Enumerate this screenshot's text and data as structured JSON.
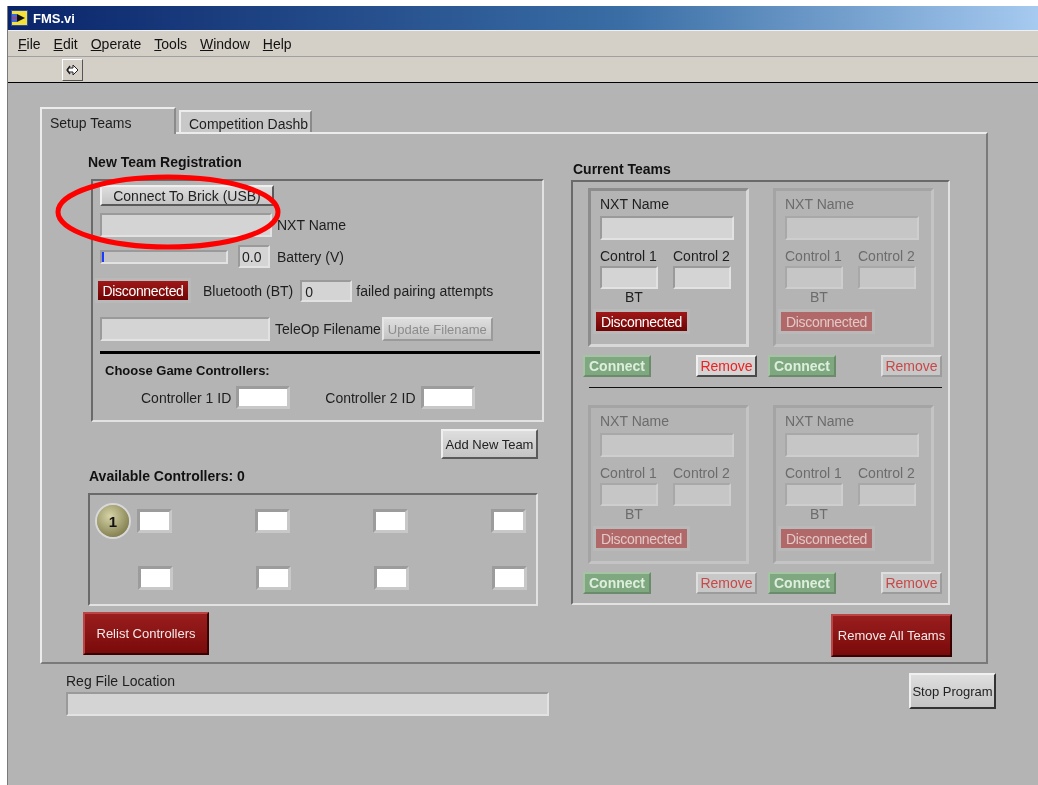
{
  "window": {
    "title": "FMS.vi"
  },
  "menu": [
    {
      "label": "File"
    },
    {
      "label": "Edit"
    },
    {
      "label": "Operate"
    },
    {
      "label": "Tools"
    },
    {
      "label": "Window"
    },
    {
      "label": "Help"
    }
  ],
  "tabs": [
    {
      "label": "Setup Teams",
      "selected": true
    },
    {
      "label": "Competition Dashb",
      "selected": false
    }
  ],
  "registration": {
    "title": "New Team Registration",
    "connect_button": "Connect To Brick (USB)",
    "nxt_name_label": "NXT Name",
    "battery": {
      "level": 0.02,
      "value": "0.0",
      "label": "Battery (V)"
    },
    "bluetooth": {
      "status": "Disconnected",
      "connected": false,
      "label": "Bluetooth (BT)",
      "failed_attempts": "0",
      "failed_label": "failed pairing attempts"
    },
    "teleop_label": "TeleOp Filename",
    "update_button": {
      "label": "Update Filename",
      "disabled": true
    },
    "controllers_title": "Choose Game Controllers:",
    "controller_1_label": "Controller 1 ID",
    "controller_2_label": "Controller 2 ID"
  },
  "add_team_button": "Add New Team",
  "available": {
    "title": "Available Controllers: 0",
    "index": "1"
  },
  "relist_button": "Relist Controllers",
  "current_teams": {
    "title": "Current Teams",
    "teams": [
      {
        "name_label": "NXT Name",
        "control_1_label": "Control 1",
        "control_2_label": "Control 2",
        "bt_label": "BT",
        "status": "Disconnected",
        "connected": false,
        "disabled": false,
        "connect_button": "Connect",
        "remove_button": "Remove"
      },
      {
        "name_label": "NXT Name",
        "control_1_label": "Control 1",
        "control_2_label": "Control 2",
        "bt_label": "BT",
        "status": "Disconnected",
        "connected": false,
        "disabled": true,
        "connect_button": "Connect",
        "remove_button": "Remove"
      },
      {
        "name_label": "NXT Name",
        "control_1_label": "Control 1",
        "control_2_label": "Control 2",
        "bt_label": "BT",
        "status": "Disconnected",
        "connected": false,
        "disabled": true,
        "connect_button": "Connect",
        "remove_button": "Remove"
      },
      {
        "name_label": "NXT Name",
        "control_1_label": "Control 1",
        "control_2_label": "Control 2",
        "bt_label": "BT",
        "status": "Disconnected",
        "connected": false,
        "disabled": true,
        "connect_button": "Connect",
        "remove_button": "Remove"
      }
    ]
  },
  "remove_all_button": "Remove All Teams",
  "reg_file": {
    "label": "Reg File Location"
  },
  "stop_button": "Stop Program"
}
